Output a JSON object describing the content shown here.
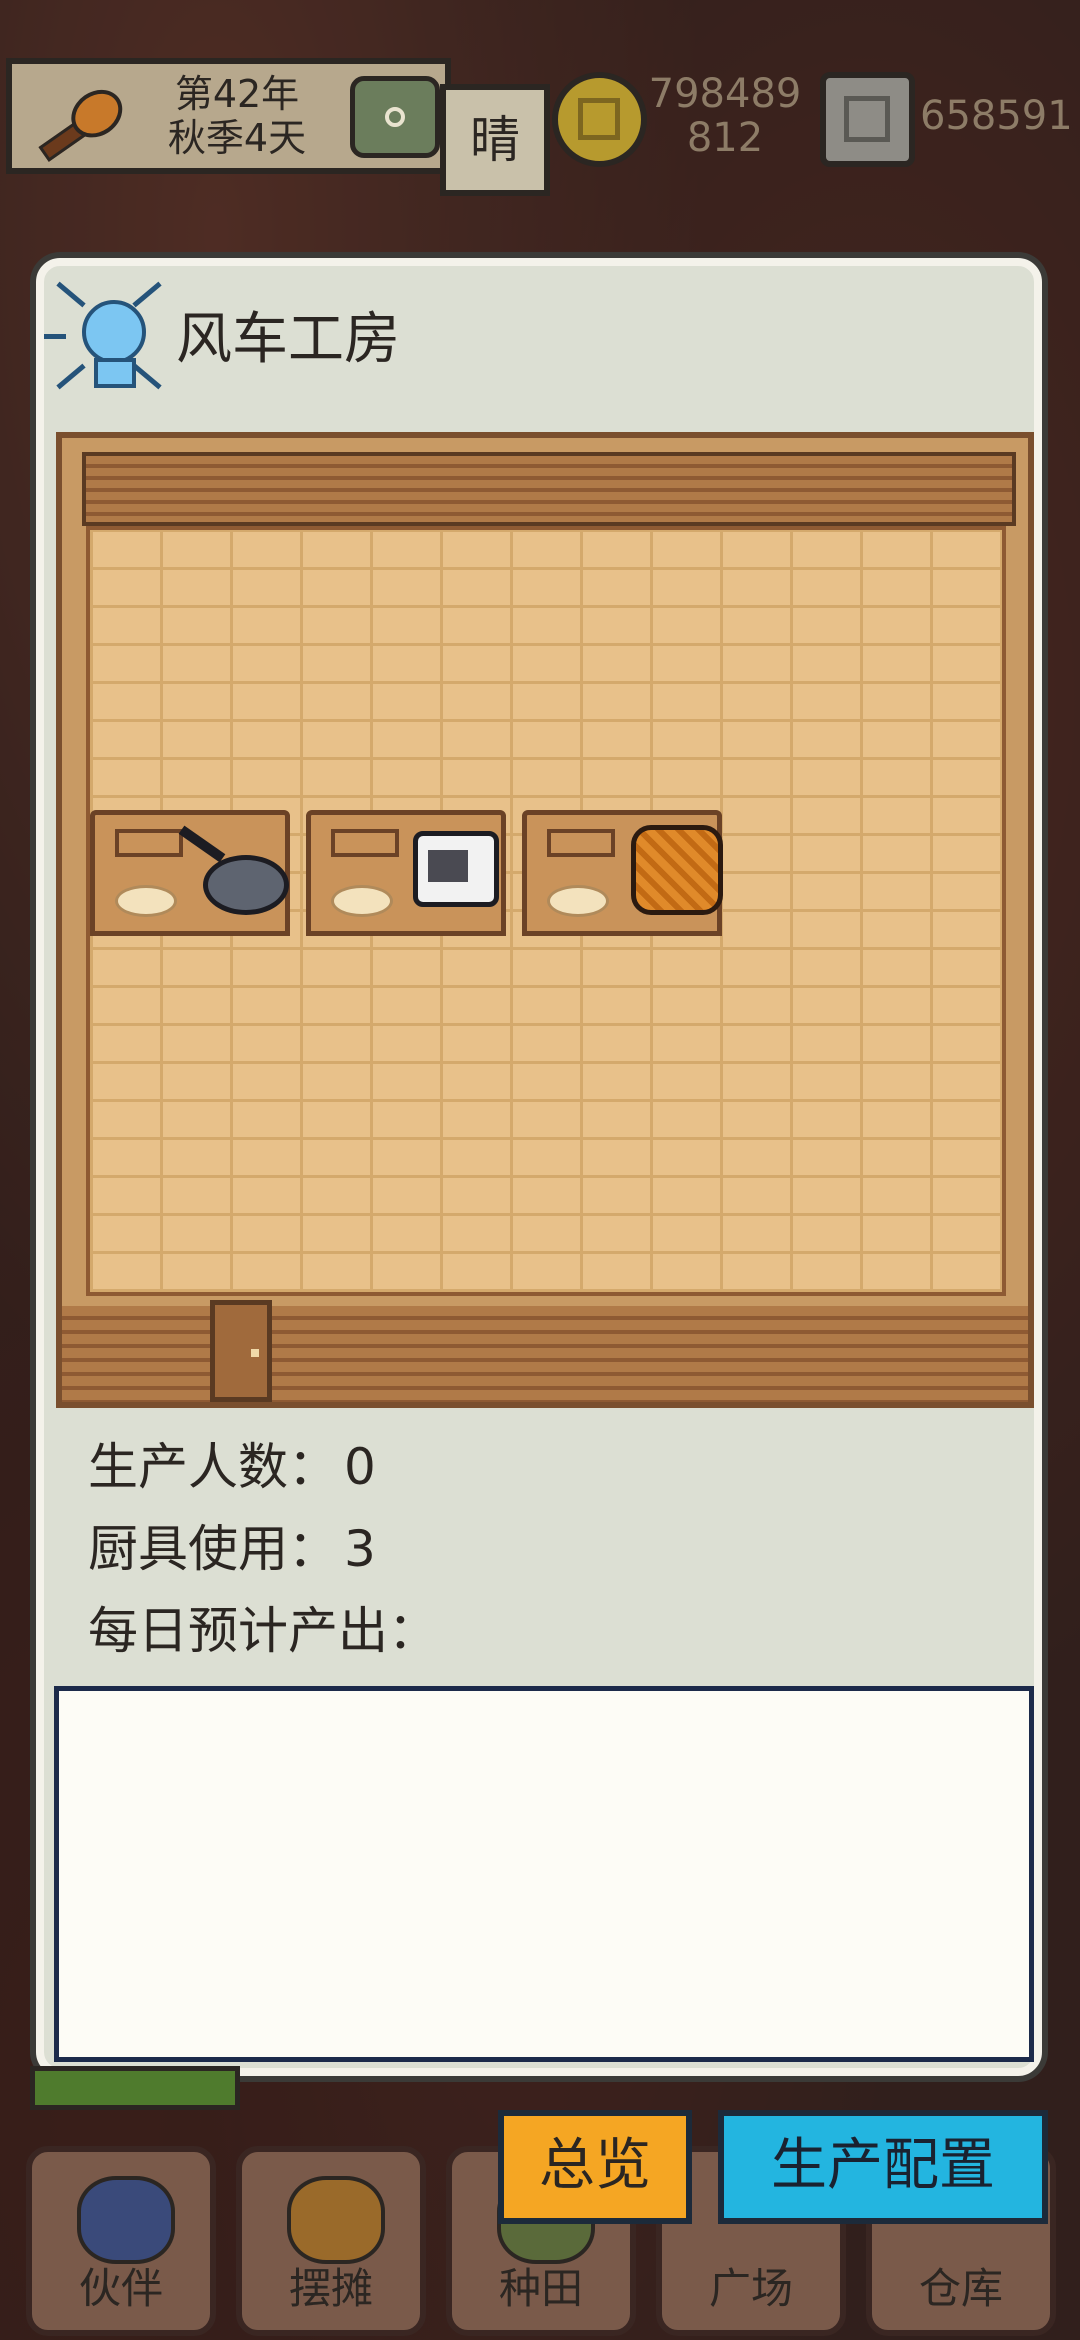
{
  "hud": {
    "date_line1": "第42年",
    "date_line2": "秋季4天",
    "weather": "晴",
    "money1_line1": "798489",
    "money1_line2": "812",
    "money2": "658591"
  },
  "dialog": {
    "title": "风车工房",
    "icon": "lightbulb-icon",
    "stats": [
      {
        "label": "生产人数：",
        "value": "0"
      },
      {
        "label": "厨具使用：",
        "value": "3"
      },
      {
        "label": "每日预计产出：",
        "value": ""
      }
    ],
    "equipment": [
      {
        "name": "frying-pan"
      },
      {
        "name": "oven"
      },
      {
        "name": "basket"
      }
    ]
  },
  "buttons": {
    "overview": "总览",
    "config": "生产配置"
  },
  "nav": {
    "items": [
      {
        "label": "伙伴",
        "icon": "partner-icon"
      },
      {
        "label": "摆摊",
        "icon": "stall-icon"
      },
      {
        "label": "种田",
        "icon": "farm-icon"
      },
      {
        "label": "广场",
        "icon": "plaza-icon"
      },
      {
        "label": "仓库",
        "icon": "warehouse-icon"
      }
    ]
  },
  "colors": {
    "overview_button": "#f5a623",
    "config_button": "#23b5e0",
    "dialog_bg": "#dcdfd3"
  }
}
